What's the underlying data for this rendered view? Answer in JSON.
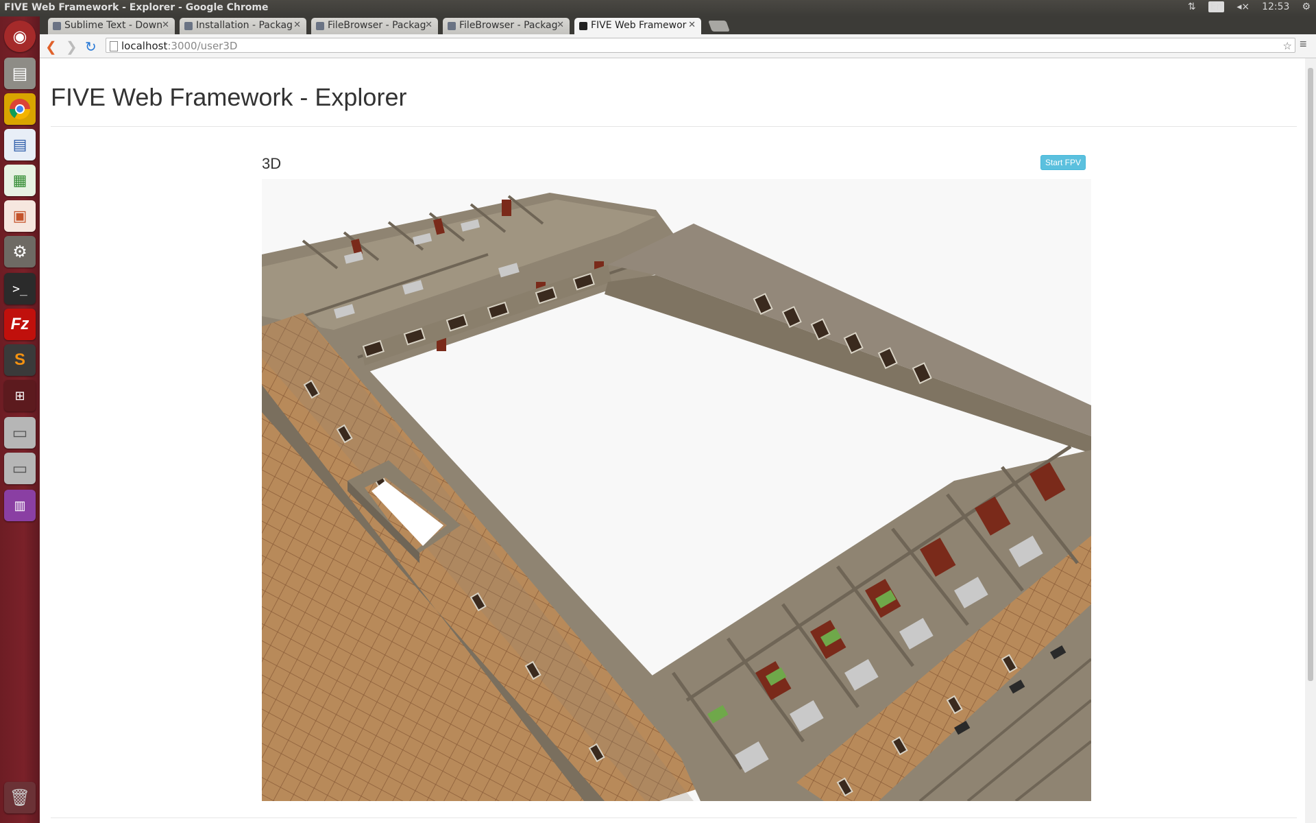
{
  "os": {
    "window_title": "FIVE Web Framework - Explorer - Google Chrome",
    "keyboard_layout": "En",
    "clock": "12:53"
  },
  "browser": {
    "tabs": [
      {
        "label": "Sublime Text - Down"
      },
      {
        "label": "Installation - Packag"
      },
      {
        "label": "FileBrowser - Packag"
      },
      {
        "label": "FileBrowser - Packag"
      },
      {
        "label": "FIVE Web Framewor",
        "active": true
      }
    ],
    "url_host": "localhost",
    "url_path": ":3000/user3D"
  },
  "launcher": {
    "icons": [
      "ubuntu-dash-icon",
      "files-icon",
      "chrome-icon",
      "writer-icon",
      "calc-icon",
      "impress-icon",
      "settings-icon",
      "terminal-icon",
      "filezilla-icon",
      "sublime-icon",
      "workspaces-icon",
      "drive-icon",
      "drive-icon",
      "app-icon",
      "trash-icon"
    ]
  },
  "page": {
    "title": "FIVE Web Framework - Explorer",
    "section_title": "3D",
    "start_fpv_label": "Start FPV"
  },
  "colors": {
    "launcher": "#7a2129",
    "panel": "#3c3b37",
    "button_info": "#5bc0de",
    "wall": "#8a7f6c",
    "floor_tile": "#b88a5a",
    "door": "#7a2a1a"
  }
}
